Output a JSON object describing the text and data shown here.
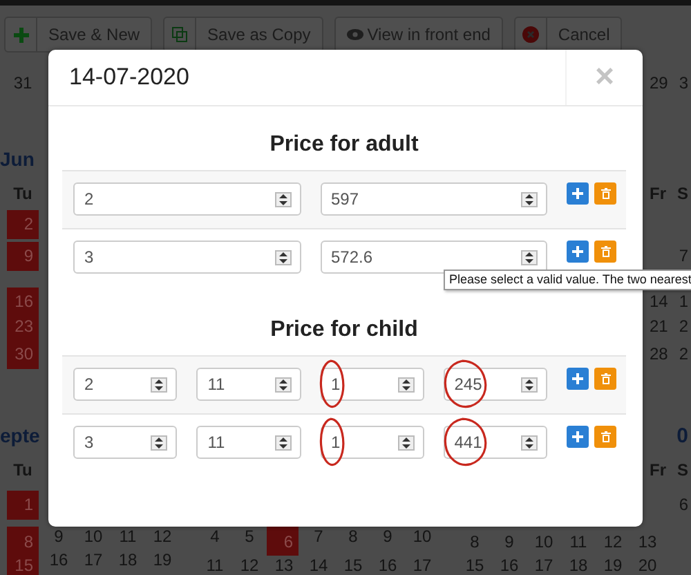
{
  "toolbar": [
    {
      "kind": "plus",
      "label": "Save & New"
    },
    {
      "kind": "copy",
      "label": "Save as Copy"
    },
    {
      "kind": "eye",
      "label": "View in front end"
    },
    {
      "kind": "cancel",
      "label": "Cancel"
    }
  ],
  "calendar_rows": [
    {
      "left": [
        {
          "text": "31",
          "kind": "day"
        }
      ],
      "right": [
        {
          "text": "29",
          "kind": "day"
        },
        {
          "text": "3",
          "kind": "day"
        }
      ]
    },
    {
      "left": [
        {
          "text": "Jun",
          "kind": "month"
        }
      ],
      "right": []
    },
    {
      "left": [
        {
          "text": "Tu",
          "kind": "weekday"
        }
      ],
      "right": [
        {
          "text": "Fr",
          "kind": "weekday"
        },
        {
          "text": "S",
          "kind": "weekday"
        }
      ]
    },
    {
      "left": [
        {
          "text": "2",
          "kind": "booked"
        }
      ],
      "right": []
    },
    {
      "left": [
        {
          "text": "9",
          "kind": "booked"
        }
      ],
      "right": [
        {
          "text": "7",
          "kind": "day"
        }
      ]
    },
    {
      "left": [
        {
          "text": "16",
          "kind": "booked"
        }
      ],
      "right": [
        {
          "text": "14",
          "kind": "day"
        },
        {
          "text": "1",
          "kind": "day"
        }
      ]
    },
    {
      "left": [
        {
          "text": "23",
          "kind": "booked"
        }
      ],
      "right": [
        {
          "text": "21",
          "kind": "day"
        },
        {
          "text": "2",
          "kind": "day"
        }
      ]
    },
    {
      "left": [
        {
          "text": "30",
          "kind": "booked"
        }
      ],
      "right": [
        {
          "text": "28",
          "kind": "day"
        },
        {
          "text": "2",
          "kind": "day"
        }
      ]
    },
    {
      "left": [
        {
          "text": "epte",
          "kind": "month"
        }
      ],
      "right": [
        {
          "text": "0",
          "kind": "month"
        }
      ]
    },
    {
      "left": [
        {
          "text": "Tu",
          "kind": "weekday"
        }
      ],
      "right": [
        {
          "text": "Fr",
          "kind": "weekday"
        },
        {
          "text": "S",
          "kind": "weekday"
        }
      ]
    },
    {
      "left": [
        {
          "text": "1",
          "kind": "booked"
        }
      ],
      "right": [
        {
          "text": "6",
          "kind": "day"
        }
      ]
    }
  ],
  "calendar_bottom": [
    [
      [
        {
          "text": "8",
          "kind": "booked"
        },
        {
          "text": "9",
          "kind": "day"
        },
        {
          "text": "10",
          "kind": "day"
        },
        {
          "text": "11",
          "kind": "day"
        },
        {
          "text": "12",
          "kind": "day"
        }
      ],
      [
        {
          "text": "4",
          "kind": "day"
        },
        {
          "text": "5",
          "kind": "day"
        },
        {
          "text": "6",
          "kind": "booked"
        },
        {
          "text": "7",
          "kind": "day"
        },
        {
          "text": "8",
          "kind": "day"
        },
        {
          "text": "9",
          "kind": "day"
        },
        {
          "text": "10",
          "kind": "day"
        }
      ],
      [
        {
          "text": "8",
          "kind": "day"
        },
        {
          "text": "9",
          "kind": "day"
        },
        {
          "text": "10",
          "kind": "day"
        },
        {
          "text": "11",
          "kind": "day"
        },
        {
          "text": "12",
          "kind": "day"
        },
        {
          "text": "13",
          "kind": "day"
        }
      ]
    ],
    [
      [
        {
          "text": "15",
          "kind": "booked"
        },
        {
          "text": "16",
          "kind": "day"
        },
        {
          "text": "17",
          "kind": "day"
        },
        {
          "text": "18",
          "kind": "day"
        },
        {
          "text": "19",
          "kind": "day"
        }
      ],
      [
        {
          "text": "11",
          "kind": "day"
        },
        {
          "text": "12",
          "kind": "day"
        },
        {
          "text": "13",
          "kind": "day"
        },
        {
          "text": "14",
          "kind": "day"
        },
        {
          "text": "15",
          "kind": "day"
        },
        {
          "text": "16",
          "kind": "day"
        },
        {
          "text": "17",
          "kind": "day"
        }
      ],
      [
        {
          "text": "15",
          "kind": "day"
        },
        {
          "text": "16",
          "kind": "day"
        },
        {
          "text": "17",
          "kind": "day"
        },
        {
          "text": "18",
          "kind": "day"
        },
        {
          "text": "19",
          "kind": "day"
        },
        {
          "text": "20",
          "kind": "day"
        }
      ]
    ]
  ],
  "modal": {
    "title": "14-07-2020",
    "close": "×",
    "sections": [
      {
        "title": "Price for adult",
        "rows": [
          {
            "fields": [
              {
                "value": "2",
                "circled": false
              },
              {
                "value": "597",
                "circled": false
              }
            ]
          },
          {
            "fields": [
              {
                "value": "3",
                "circled": false
              },
              {
                "value": "572.6",
                "circled": false
              }
            ]
          }
        ]
      },
      {
        "title": "Price for child",
        "rows": [
          {
            "fields": [
              {
                "value": "2",
                "circled": false
              },
              {
                "value": "11",
                "circled": false
              },
              {
                "value": "1",
                "circled": true
              },
              {
                "value": "245",
                "circled": true
              }
            ]
          },
          {
            "fields": [
              {
                "value": "3",
                "circled": false
              },
              {
                "value": "11",
                "circled": false
              },
              {
                "value": "1",
                "circled": true
              },
              {
                "value": "441",
                "circled": true
              }
            ]
          }
        ]
      }
    ],
    "tooltip": "Please select a valid value. The two nearest"
  }
}
